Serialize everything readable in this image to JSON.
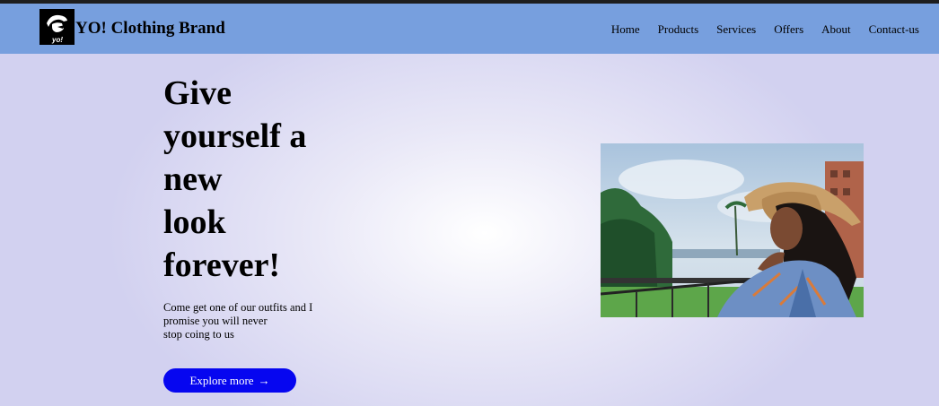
{
  "header": {
    "brand": "YO! Clothing Brand",
    "logo_text": "yo!",
    "nav": [
      "Home",
      "Products",
      "Services",
      "Offers",
      "About",
      "Contact-us"
    ]
  },
  "hero": {
    "title_lines": [
      "Give",
      "yourself a",
      "new",
      "look",
      "forever!"
    ],
    "subtitle_lines": [
      "Come get one of our outfits and I",
      "promise you will never",
      "stop coing to us"
    ],
    "cta_label": "Explore more",
    "cta_arrow": "→"
  },
  "colors": {
    "navbar": "#779fde",
    "cta": "#0606f0"
  },
  "icons": {
    "logo": "yo-logo-icon",
    "cta_arrow": "arrow-right-icon"
  }
}
